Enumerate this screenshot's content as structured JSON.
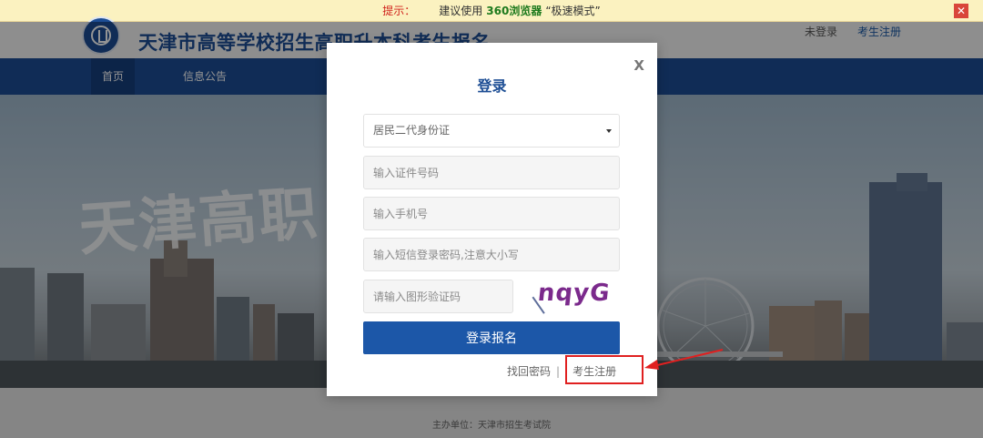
{
  "tip_bar": {
    "label": "提示：",
    "text_before": "建议使用",
    "browser": "360浏览器",
    "text_after": "“极速模式”",
    "close_glyph": "✕"
  },
  "header": {
    "title": "天津市高等学校招生高职升本科考生报名",
    "login_status": "未登录",
    "register_link": "考生注册"
  },
  "nav": {
    "items": [
      {
        "label": "首页",
        "active": true
      },
      {
        "label": "信息公告",
        "active": false
      }
    ]
  },
  "banner": {
    "text": "天津高职"
  },
  "footer": {
    "text": "主办单位：天津市招生考试院"
  },
  "modal": {
    "title": "登录",
    "close_label": "X",
    "id_type": {
      "selected": "居民二代身份证"
    },
    "id_number": {
      "placeholder": "输入证件号码"
    },
    "phone": {
      "placeholder": "输入手机号"
    },
    "sms_password": {
      "placeholder": "输入短信登录密码,注意大小写"
    },
    "captcha": {
      "placeholder": "请输入图形验证码",
      "image_text": "nqyG"
    },
    "submit_label": "登录报名",
    "forgot_password": "找回密码",
    "separator": "|",
    "register": "考生注册"
  },
  "colors": {
    "primary": "#1c4d94",
    "button": "#1c57a8",
    "annotation": "#e02020",
    "tip_background": "#fbf2c0"
  }
}
